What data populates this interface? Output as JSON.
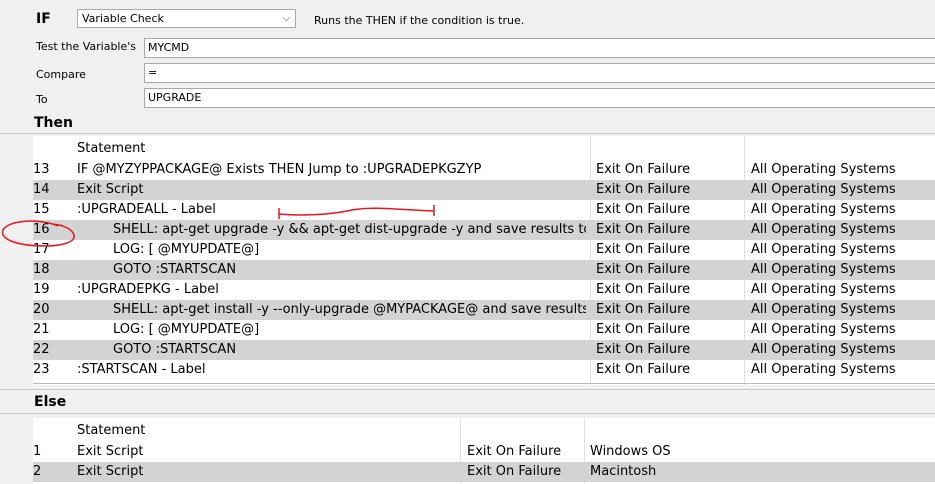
{
  "if_section": {
    "label": "IF",
    "condition_select": "Variable Check",
    "description": "Runs the THEN if the condition is true.",
    "test_variable_label": "Test the Variable's",
    "test_variable_value": "MYCMD",
    "compare_label": "Compare",
    "compare_value": "=",
    "to_label": "To",
    "to_value": "UPGRADE"
  },
  "then_section": {
    "label": "Then",
    "header": {
      "statement": "Statement"
    },
    "rows": [
      {
        "num": "13",
        "statement": "IF  @MYZYPPACKAGE@  Exists    THEN  Jump to :UPGRADEPKGZYP",
        "indent": false,
        "failure": "Exit On Failure",
        "os": "All Operating Systems"
      },
      {
        "num": "14",
        "statement": "Exit Script",
        "indent": false,
        "failure": "Exit On Failure",
        "os": "All Operating Systems"
      },
      {
        "num": "15",
        "statement": ":UPGRADEALL - Label",
        "indent": false,
        "failure": "Exit On Failure",
        "os": "All Operating Systems"
      },
      {
        "num": "16",
        "statement": "SHELL:   apt-get upgrade -y && apt-get dist-upgrade -y and save results to @M...",
        "indent": true,
        "failure": "Exit On Failure",
        "os": "All Operating Systems"
      },
      {
        "num": "17",
        "statement": "LOG:  [ @MYUPDATE@]",
        "indent": true,
        "failure": "Exit On Failure",
        "os": "All Operating Systems"
      },
      {
        "num": "18",
        "statement": "GOTO :STARTSCAN",
        "indent": true,
        "failure": "Exit On Failure",
        "os": "All Operating Systems"
      },
      {
        "num": "19",
        "statement": ":UPGRADEPKG - Label",
        "indent": false,
        "failure": "Exit On Failure",
        "os": "All Operating Systems"
      },
      {
        "num": "20",
        "statement": "SHELL:   apt-get install  -y --only-upgrade @MYPACKAGE@ and save results to ...",
        "indent": true,
        "failure": "Exit On Failure",
        "os": "All Operating Systems"
      },
      {
        "num": "21",
        "statement": "LOG:  [ @MYUPDATE@]",
        "indent": true,
        "failure": "Exit On Failure",
        "os": "All Operating Systems"
      },
      {
        "num": "22",
        "statement": "GOTO :STARTSCAN",
        "indent": true,
        "failure": "Exit On Failure",
        "os": "All Operating Systems"
      },
      {
        "num": "23",
        "statement": ":STARTSCAN - Label",
        "indent": false,
        "failure": "Exit On Failure",
        "os": "All Operating Systems"
      }
    ]
  },
  "else_section": {
    "label": "Else",
    "header": {
      "statement": "Statement"
    },
    "rows": [
      {
        "num": "1",
        "statement": "Exit Script",
        "failure": "Exit On Failure",
        "os": "Windows OS"
      },
      {
        "num": "2",
        "statement": "Exit Script",
        "failure": "Exit On Failure",
        "os": "Macintosh"
      }
    ]
  },
  "annotation_color": "#e8141e",
  "alt_row_color": "#d3d3d3"
}
